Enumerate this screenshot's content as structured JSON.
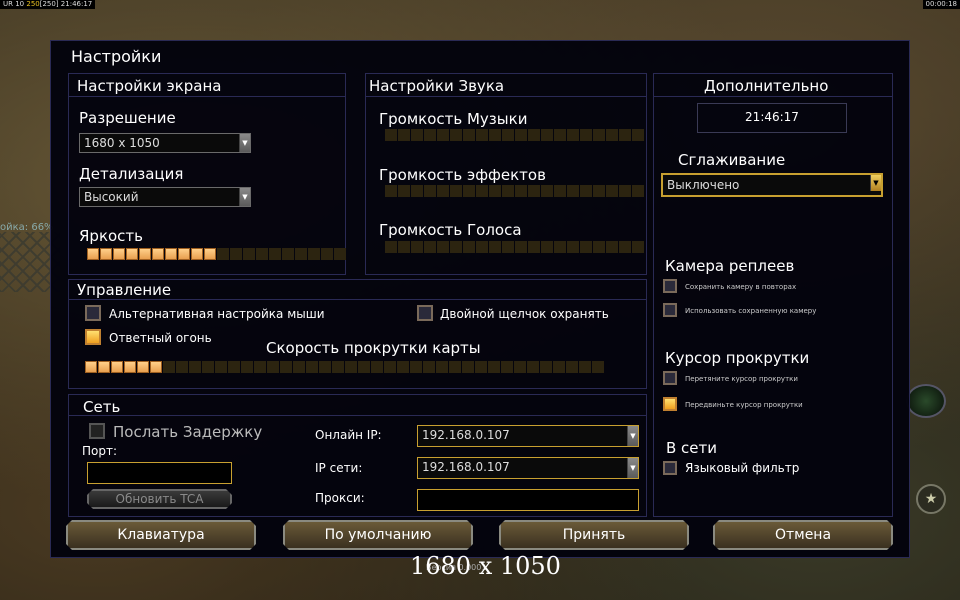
{
  "hud": {
    "left_prefix": "UR 10",
    "left_money": "250",
    "left_bracket": "[250]",
    "left_time": "21:46:17",
    "right_time": "00:00:18"
  },
  "background": {
    "side_label": "ойка: 66%",
    "emblem_icon": "star-icon"
  },
  "dialog": {
    "title": "Настройки"
  },
  "screen": {
    "title": "Настройки экрана",
    "resolution_label": "Разрешение",
    "resolution_value": "1680 x 1050",
    "detail_label": "Детализация",
    "detail_value": "Высокий",
    "brightness_label": "Яркость",
    "brightness_level": 0.5
  },
  "sound": {
    "title": "Настройки Звука",
    "music_label": "Громкость Музыки",
    "music_level": 0,
    "effects_label": "Громкость эффектов",
    "effects_level": 0,
    "voice_label": "Громкость Голоса",
    "voice_level": 0
  },
  "extra": {
    "title": "Дополнительно",
    "clock": "21:46:17",
    "antialias_label": "Сглаживание",
    "antialias_value": "Выключено",
    "replay_camera_label": "Камера реплеев",
    "replay_save_camera": "Сохранить камеру в повторах",
    "replay_use_camera": "Использовать сохраненную камеру",
    "scroll_cursor_label": "Курсор прокрутки",
    "scroll_drag": "Перетяните курсор прокрутки",
    "scroll_move": "Передвиньте курсор прокрутки",
    "online_label": "В сети",
    "language_filter": "Языковый фильтр"
  },
  "control": {
    "title": "Управление",
    "alt_mouse": "Альтернативная настройка мыши",
    "double_click": "Двойной щелчок охранять",
    "return_fire": "Ответный огонь",
    "scroll_speed_label": "Скорость прокрутки карты",
    "scroll_speed_level": 0.16
  },
  "network": {
    "title": "Сеть",
    "send_delay": "Послать Задержку",
    "port_label": "Порт:",
    "port_value": "",
    "refresh_tca": "Обновить TCA",
    "online_ip_label": "Онлайн IP:",
    "online_ip_value": "192.168.0.107",
    "lan_ip_label": "IP сети:",
    "lan_ip_value": "192.168.0.107",
    "proxy_label": "Прокси:",
    "proxy_value": ""
  },
  "buttons": {
    "keyboard": "Клавиатура",
    "defaults": "По умолчанию",
    "accept": "Принять",
    "cancel": "Отмена"
  },
  "bottom": {
    "resolution": "1680 x 1050",
    "shadow_text": "Версия 0.0001"
  }
}
